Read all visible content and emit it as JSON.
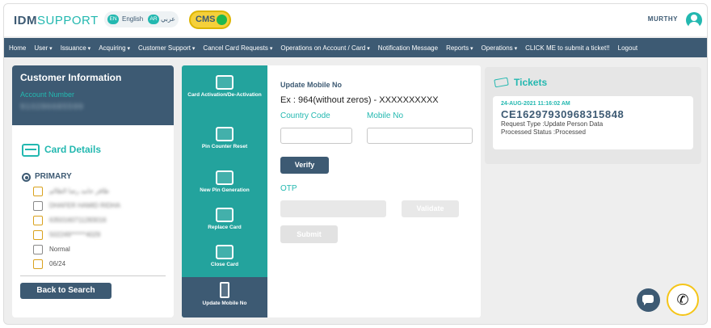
{
  "header": {
    "logo_idm": "IDM",
    "logo_support": "SUPPORT",
    "lang_en_badge": "EN",
    "lang_en_label": "English",
    "lang_ar_badge": "AR",
    "lang_ar_label": "عربي",
    "cms_label": "CMS",
    "username": "MURTHY"
  },
  "nav": {
    "items": [
      {
        "label": "Home",
        "dropdown": false
      },
      {
        "label": "User",
        "dropdown": true
      },
      {
        "label": "Issuance",
        "dropdown": true
      },
      {
        "label": "Acquiring",
        "dropdown": true
      },
      {
        "label": "Customer Support",
        "dropdown": true
      },
      {
        "label": "Cancel Card Requests",
        "dropdown": true
      },
      {
        "label": "Operations on Account / Card",
        "dropdown": true
      },
      {
        "label": "Notification Message",
        "dropdown": false
      },
      {
        "label": "Reports",
        "dropdown": true
      },
      {
        "label": "Operations",
        "dropdown": true
      },
      {
        "label": "CLICK ME to submit a ticket!!",
        "dropdown": false
      },
      {
        "label": "Logout",
        "dropdown": false
      }
    ]
  },
  "customer": {
    "title": "Customer Information",
    "account_label": "Account Number",
    "account_value": "910286685599",
    "card_details_title": "Card Details",
    "card_type": "PRIMARY",
    "details": [
      {
        "icon": "person-icon",
        "text": "ظافر حامد رضا الظالم",
        "blurred": true
      },
      {
        "icon": "id-card-icon",
        "text": "DHAFER HAMID RIDHA",
        "blurred": true
      },
      {
        "icon": "card-number-icon",
        "text": "6350160711283016",
        "blurred": true
      },
      {
        "icon": "masked-card-icon",
        "text": "502249******4029",
        "blurred": true
      },
      {
        "icon": "status-icon",
        "text": "Normal",
        "blurred": false
      },
      {
        "icon": "calendar-icon",
        "text": "06/24",
        "blurred": false
      }
    ],
    "back_button": "Back to Search"
  },
  "actions": {
    "items": [
      {
        "label": "Card Activation/De-Activation",
        "active": false
      },
      {
        "label": "Pin Counter Reset",
        "active": false
      },
      {
        "label": "New Pin Generation",
        "active": false
      },
      {
        "label": "Replace Card",
        "active": false
      },
      {
        "label": "Close Card",
        "active": false
      },
      {
        "label": "Update Mobile No",
        "active": true
      }
    ]
  },
  "form": {
    "title": "Update Mobile No",
    "example": "Ex : 964(without zeros) - XXXXXXXXXX",
    "country_code_label": "Country Code",
    "country_code_value": "",
    "mobile_label": "Mobile No",
    "mobile_value": "",
    "verify_button": "Verify",
    "otp_label": "OTP",
    "otp_value": "",
    "validate_button": "Validate",
    "submit_button": "Submit"
  },
  "tickets": {
    "title": "Tickets",
    "items": [
      {
        "date": "24-AUG-2021 11:16:02 AM",
        "number": "CE16297930968315848",
        "request_type": "Request Type :Update Person Data",
        "status": "Processed Status :Processed"
      }
    ]
  },
  "colors": {
    "primary_dark": "#3d5a73",
    "teal": "#23b8b0",
    "cms_yellow": "#f5d03a",
    "cms_green": "#1fb84f"
  }
}
